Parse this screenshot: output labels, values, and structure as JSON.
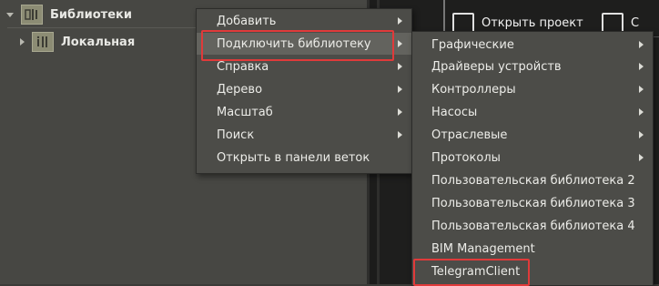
{
  "tree": {
    "root_label": "Библиотеки",
    "child_label": "Локальная"
  },
  "toolbar": {
    "open_project_label": "Открыть проект",
    "save_label": "С"
  },
  "context_menu": {
    "items": [
      {
        "label": "Добавить",
        "has_submenu": true
      },
      {
        "label": "Подключить библиотеку",
        "has_submenu": true
      },
      {
        "label": "Справка",
        "has_submenu": true
      },
      {
        "label": "Дерево",
        "has_submenu": true
      },
      {
        "label": "Масштаб",
        "has_submenu": true
      },
      {
        "label": "Поиск",
        "has_submenu": true
      },
      {
        "label": "Открыть в панели веток",
        "has_submenu": false
      }
    ]
  },
  "submenu": {
    "items": [
      {
        "label": "Графические",
        "has_submenu": true
      },
      {
        "label": "Драйверы устройств",
        "has_submenu": true
      },
      {
        "label": "Контроллеры",
        "has_submenu": true
      },
      {
        "label": "Насосы",
        "has_submenu": true
      },
      {
        "label": "Отраслевые",
        "has_submenu": true
      },
      {
        "label": "Протоколы",
        "has_submenu": true
      },
      {
        "label": "Пользовательская библиотека 2",
        "has_submenu": false
      },
      {
        "label": "Пользовательская библиотека 3",
        "has_submenu": false
      },
      {
        "label": "Пользовательская библиотека 4",
        "has_submenu": false
      },
      {
        "label": "BIM Management",
        "has_submenu": false
      },
      {
        "label": "TelegramClient",
        "has_submenu": false
      }
    ]
  },
  "colors": {
    "highlight_border": "#e03a3a",
    "menu_bg": "#4c4c48",
    "tree_bg": "#474743"
  }
}
